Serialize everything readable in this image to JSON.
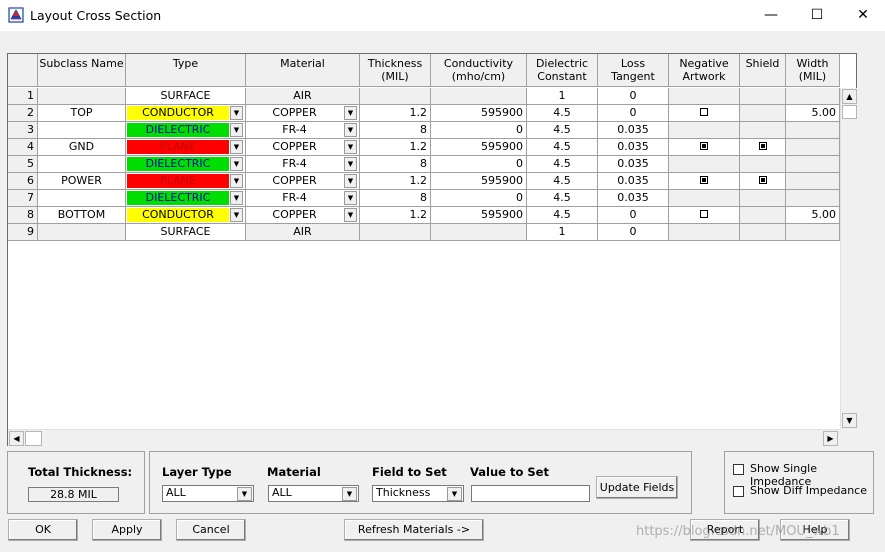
{
  "window": {
    "title": "Layout Cross Section",
    "minimize": "—",
    "maximize": "☐",
    "close": "✕"
  },
  "columns": [
    "",
    "Subclass Name",
    "Type",
    "Material",
    "Thickness\n(MIL)",
    "Conductivity\n(mho/cm)",
    "Dielectric\nConstant",
    "Loss\nTangent",
    "Negative\nArtwork",
    "Shield",
    "Width\n(MIL)"
  ],
  "colors": {
    "CONDUCTOR": "#ffff00",
    "PLANE": "#ff0000",
    "DIELECTRIC": "#00dd00",
    "PLANE_text": "#c00000",
    "DIELECTRIC_text": "#0000c0"
  },
  "rows": [
    {
      "num": "1",
      "name": "",
      "type": "SURFACE",
      "material": "AIR",
      "thickness": "",
      "conductivity": "",
      "dielectric": "1",
      "loss": "0",
      "negative": null,
      "shield": null,
      "width": ""
    },
    {
      "num": "2",
      "name": "TOP",
      "type": "CONDUCTOR",
      "material": "COPPER",
      "thickness": "1.2",
      "conductivity": "595900",
      "dielectric": "4.5",
      "loss": "0",
      "negative": false,
      "shield": null,
      "width": "5.00"
    },
    {
      "num": "3",
      "name": "",
      "type": "DIELECTRIC",
      "material": "FR-4",
      "thickness": "8",
      "conductivity": "0",
      "dielectric": "4.5",
      "loss": "0.035",
      "negative": null,
      "shield": null,
      "width": ""
    },
    {
      "num": "4",
      "name": "GND",
      "type": "PLANE",
      "material": "COPPER",
      "thickness": "1.2",
      "conductivity": "595900",
      "dielectric": "4.5",
      "loss": "0.035",
      "negative": true,
      "shield": true,
      "width": ""
    },
    {
      "num": "5",
      "name": "",
      "type": "DIELECTRIC",
      "material": "FR-4",
      "thickness": "8",
      "conductivity": "0",
      "dielectric": "4.5",
      "loss": "0.035",
      "negative": null,
      "shield": null,
      "width": ""
    },
    {
      "num": "6",
      "name": "POWER",
      "type": "PLANE",
      "material": "COPPER",
      "thickness": "1.2",
      "conductivity": "595900",
      "dielectric": "4.5",
      "loss": "0.035",
      "negative": true,
      "shield": true,
      "width": ""
    },
    {
      "num": "7",
      "name": "",
      "type": "DIELECTRIC",
      "material": "FR-4",
      "thickness": "8",
      "conductivity": "0",
      "dielectric": "4.5",
      "loss": "0.035",
      "negative": null,
      "shield": null,
      "width": ""
    },
    {
      "num": "8",
      "name": "BOTTOM",
      "type": "CONDUCTOR",
      "material": "COPPER",
      "thickness": "1.2",
      "conductivity": "595900",
      "dielectric": "4.5",
      "loss": "0",
      "negative": false,
      "shield": null,
      "width": "5.00"
    },
    {
      "num": "9",
      "name": "",
      "type": "SURFACE",
      "material": "AIR",
      "thickness": "",
      "conductivity": "",
      "dielectric": "1",
      "loss": "0",
      "negative": null,
      "shield": null,
      "width": ""
    }
  ],
  "total": {
    "label": "Total Thickness:",
    "value": "28.8 MIL"
  },
  "setter": {
    "layer_type_label": "Layer Type",
    "layer_type_value": "ALL",
    "material_label": "Material",
    "material_value": "ALL",
    "field_label": "Field to Set",
    "field_value": "Thickness",
    "value_label": "Value to Set",
    "value_value": "",
    "update_button": "Update Fields"
  },
  "options": {
    "single": "Show Single Impedance",
    "diff": "Show Diff Impedance"
  },
  "buttons": {
    "ok": "OK",
    "apply": "Apply",
    "cancel": "Cancel",
    "refresh": "Refresh Materials ->",
    "report": "Report",
    "help": "Help"
  },
  "watermark": "https://blog.csdn.net/MOU_wb1"
}
